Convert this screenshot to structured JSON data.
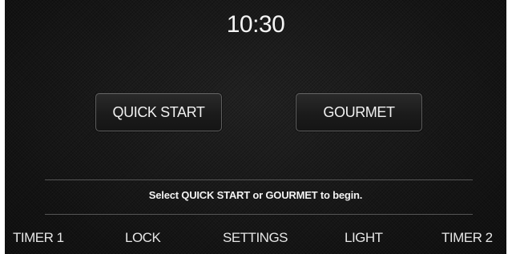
{
  "clock": {
    "time": "10:30"
  },
  "modes": {
    "quick_start_label": "QUICK START",
    "gourmet_label": "GOURMET"
  },
  "message": {
    "hint": "Select QUICK START or GOURMET to begin."
  },
  "nav": {
    "items": [
      {
        "label": "TIMER 1"
      },
      {
        "label": "LOCK"
      },
      {
        "label": "SETTINGS"
      },
      {
        "label": "LIGHT"
      },
      {
        "label": "TIMER 2"
      }
    ]
  },
  "colors": {
    "background": "#161616",
    "text": "#ffffff",
    "button_border": "#5e5e5e",
    "divider": "#555555"
  }
}
